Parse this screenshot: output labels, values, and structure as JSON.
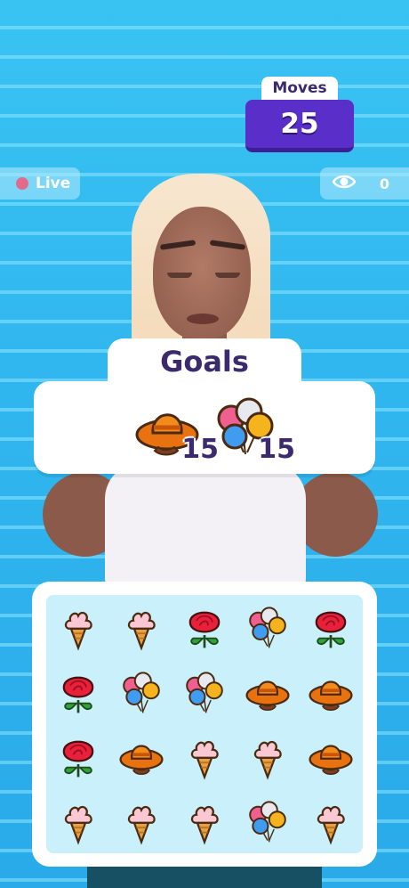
{
  "moves": {
    "label": "Moves",
    "value": "25"
  },
  "live": {
    "label": "Live",
    "dot_color": "#e36a8a"
  },
  "viewers": {
    "icon": "eye-icon",
    "count": "0"
  },
  "goals": {
    "title": "Goals",
    "items": [
      {
        "icon": "cowboy-hat-icon",
        "count": "15"
      },
      {
        "icon": "balloons-icon",
        "count": "15"
      }
    ]
  },
  "board": {
    "rows": [
      [
        "ice-cream",
        "ice-cream",
        "rose",
        "balloons",
        "rose"
      ],
      [
        "rose",
        "balloons",
        "balloons",
        "cowboy-hat",
        "cowboy-hat"
      ],
      [
        "rose",
        "cowboy-hat",
        "ice-cream",
        "ice-cream",
        "cowboy-hat"
      ],
      [
        "ice-cream",
        "ice-cream",
        "ice-cream",
        "balloons",
        "ice-cream"
      ]
    ]
  },
  "colors": {
    "accent": "#5a2fc9",
    "text": "#3b2a6e",
    "background": "#35bdf0"
  }
}
